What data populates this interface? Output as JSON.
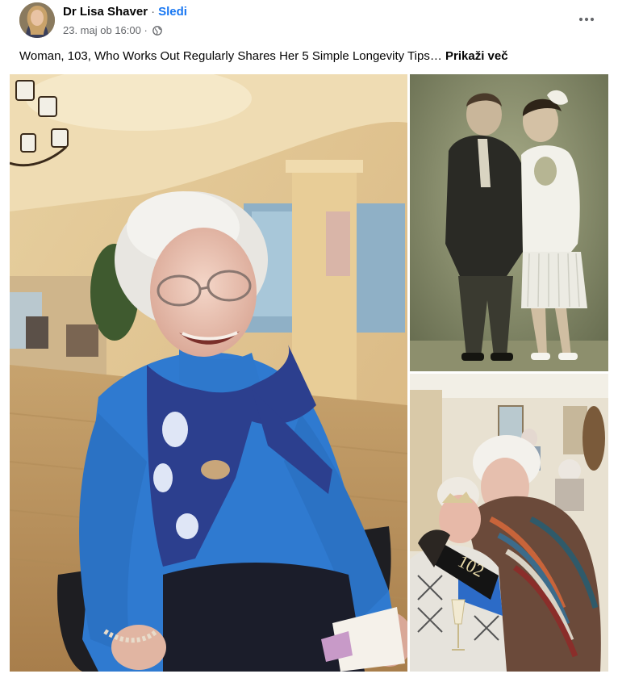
{
  "post": {
    "author": "Dr Lisa Shaver",
    "separator": "·",
    "follow_label": "Sledi",
    "timestamp": "23. maj ob 16:00",
    "timestamp_separator": "·",
    "privacy_icon": "globe-icon",
    "more_icon": "more-options-icon",
    "caption": "Woman, 103, Who Works Out Regularly Shares Her 5 Simple Longevity Tips…",
    "see_more": "Prikaži več"
  },
  "photos": {
    "count": 3,
    "badge_text": "102"
  },
  "colors": {
    "link": "#1877f2",
    "secondary_text": "#65676b",
    "sweater": "#2f7ad0",
    "scarf": "#2c3f8e"
  }
}
